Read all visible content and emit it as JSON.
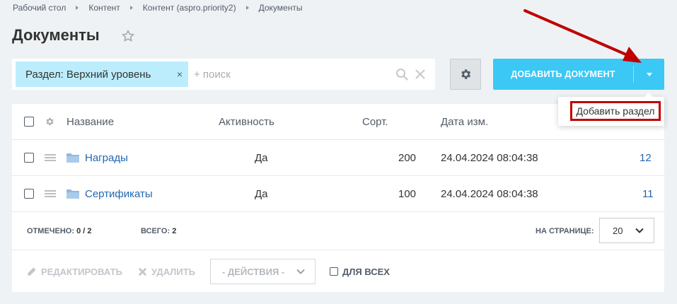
{
  "breadcrumbs": [
    "Рабочий стол",
    "Контент",
    "Контент (aspro.priority2)",
    "Документы"
  ],
  "page_title": "Документы",
  "filter": {
    "chip_label": "Раздел: Верхний уровень",
    "chip_close": "×",
    "search_placeholder": "+ поиск"
  },
  "toolbar": {
    "add_button_label": "ДОБАВИТЬ ДОКУМЕНТ"
  },
  "dropdown": {
    "items": [
      "Добавить раздел"
    ]
  },
  "table": {
    "columns": [
      "Название",
      "Активность",
      "Сорт.",
      "Дата изм."
    ],
    "rows": [
      {
        "name": "Награды",
        "active": "Да",
        "sort": "200",
        "date": "24.04.2024 08:04:38",
        "id": "12"
      },
      {
        "name": "Сертификаты",
        "active": "Да",
        "sort": "100",
        "date": "24.04.2024 08:04:38",
        "id": "11"
      }
    ]
  },
  "summary": {
    "selected_label": "ОТМЕЧЕНО:",
    "selected_value": "0 / 2",
    "total_label": "ВСЕГО:",
    "total_value": "2",
    "per_page_label": "НА СТРАНИЦЕ:",
    "per_page_value": "20"
  },
  "actions": {
    "edit_label": "РЕДАКТИРОВАТЬ",
    "delete_label": "УДАЛИТЬ",
    "actions_select": "- ДЕЙСТВИЯ -",
    "for_all_label": "ДЛЯ ВСЕХ"
  },
  "colors": {
    "accent": "#3bc8f5",
    "chip": "#bcedfc",
    "link": "#2067b0",
    "highlight": "#c00000"
  }
}
